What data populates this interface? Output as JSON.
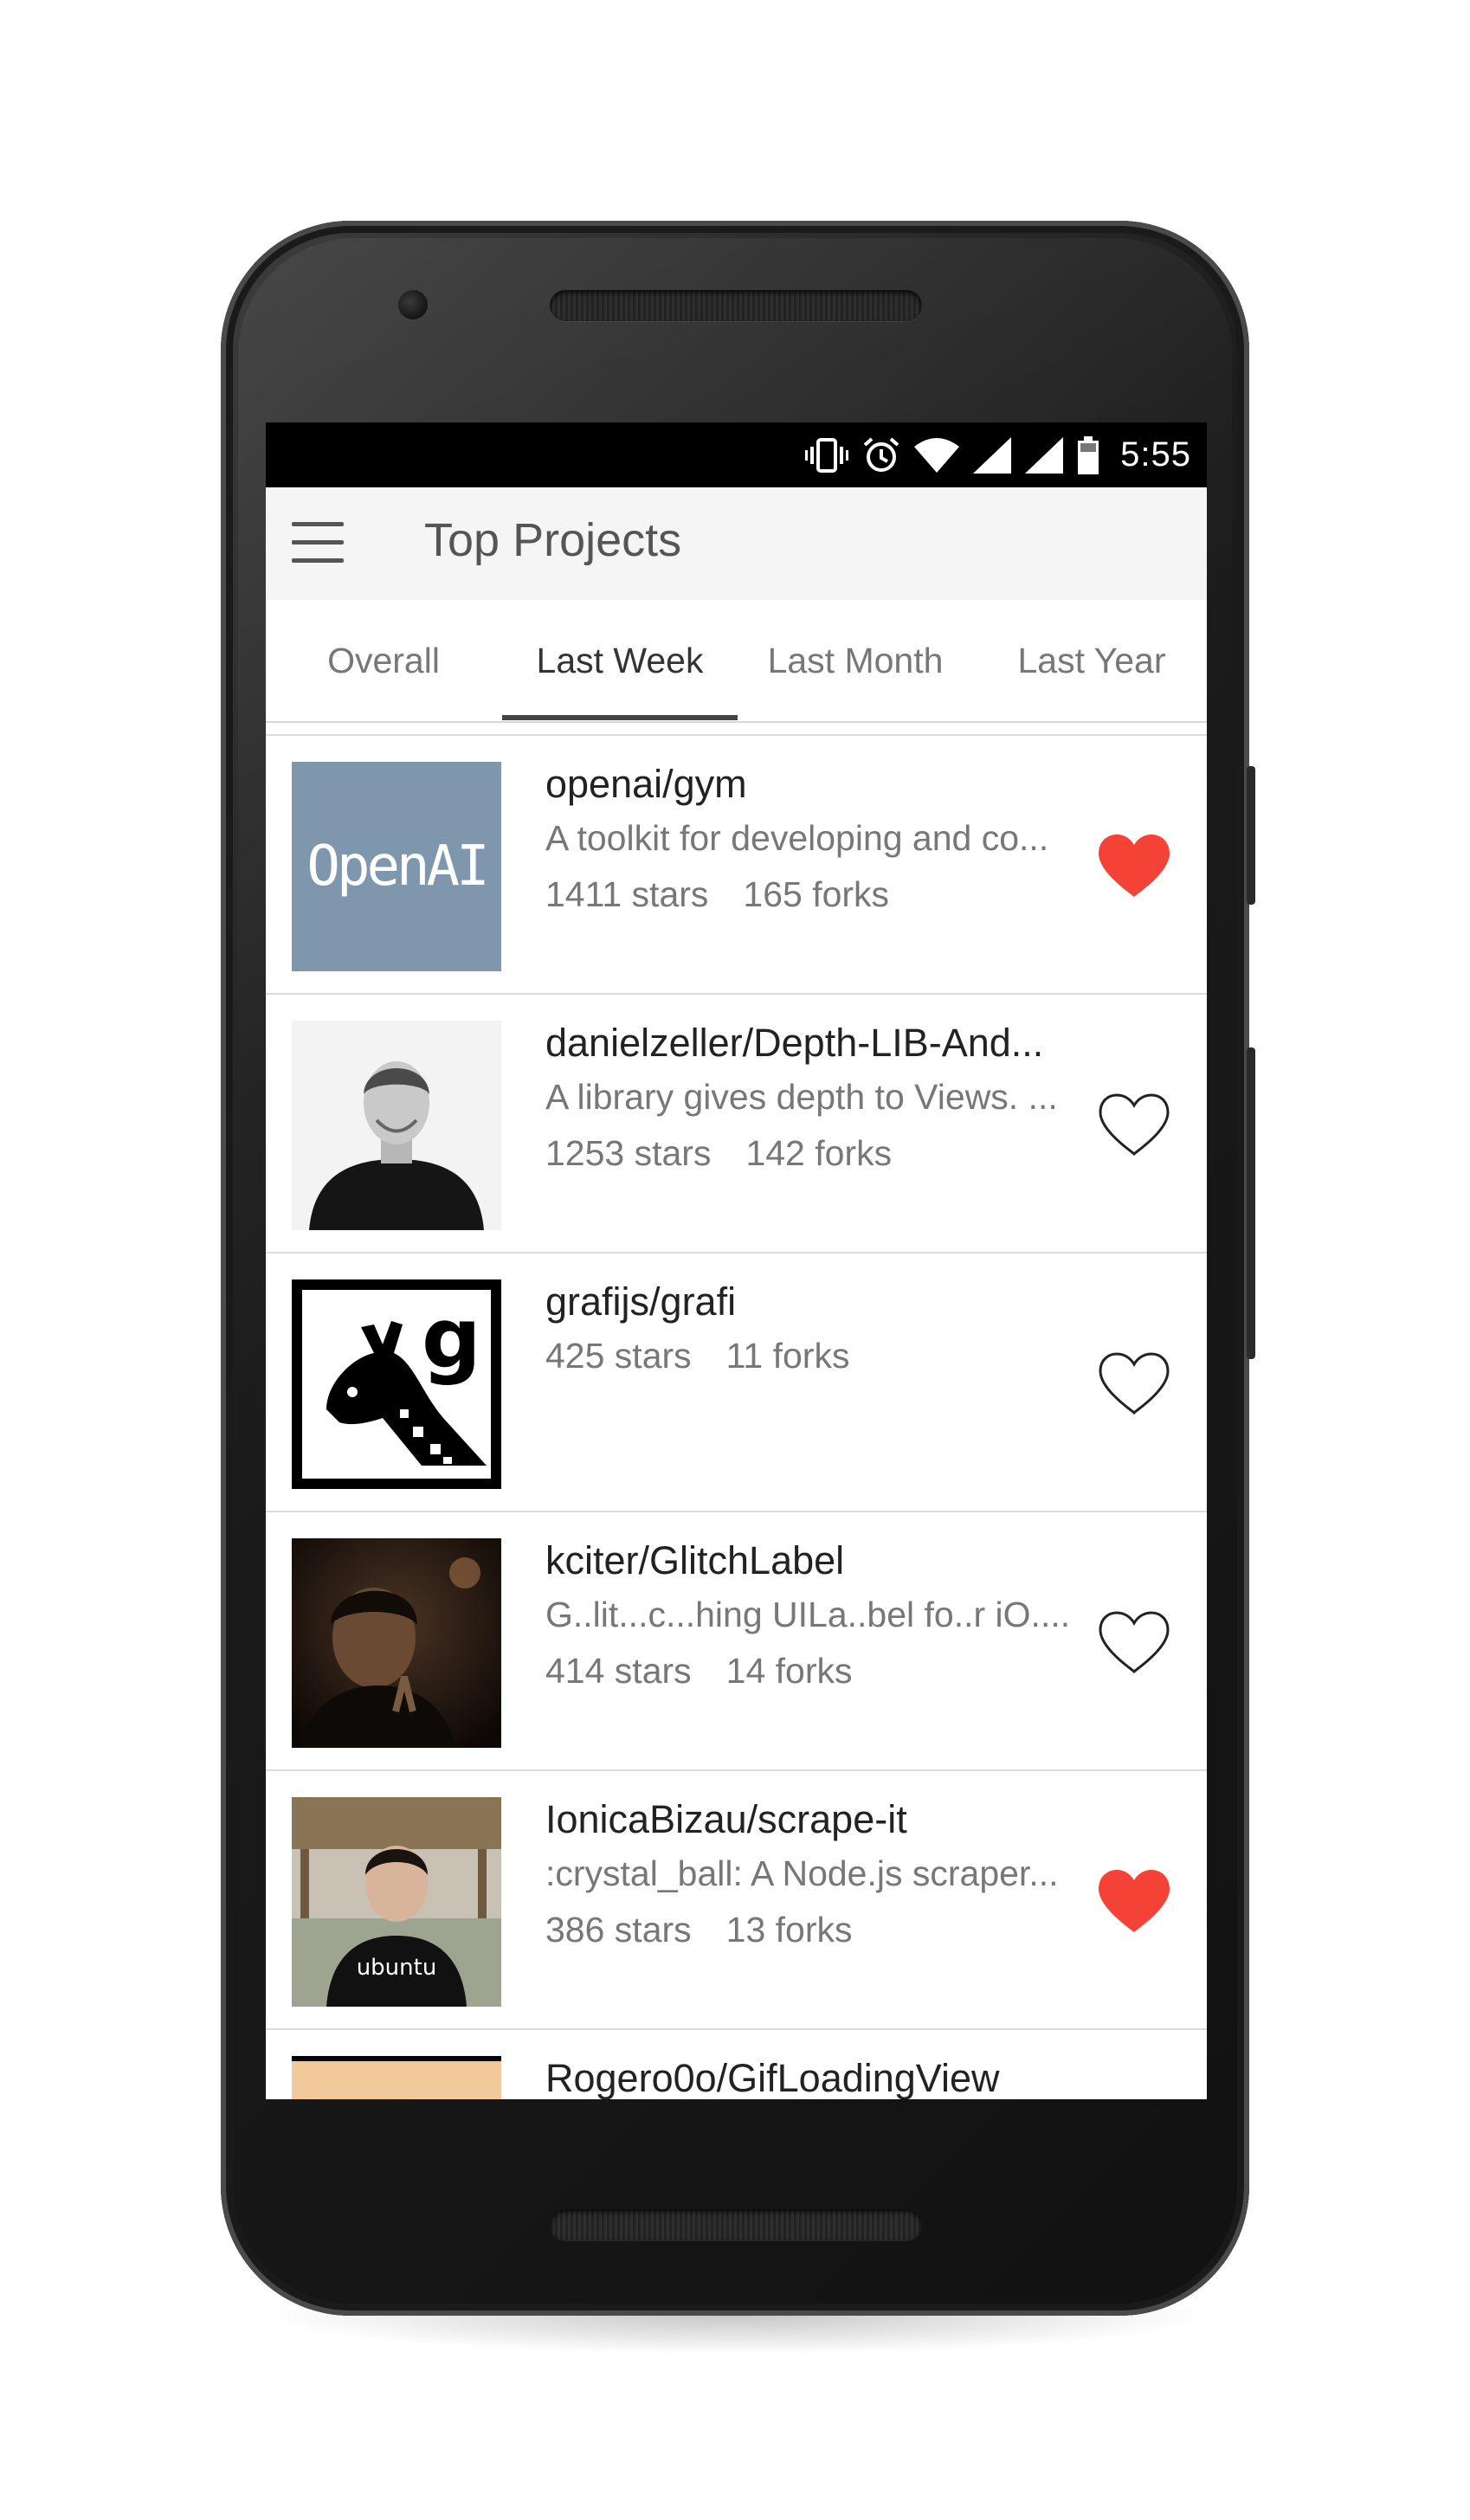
{
  "status_bar": {
    "time": "5:55"
  },
  "app_bar": {
    "title": "Top Projects"
  },
  "tabs": [
    {
      "label": "Overall"
    },
    {
      "label": "Last Week",
      "active": true
    },
    {
      "label": "Last Month"
    },
    {
      "label": "Last Year"
    }
  ],
  "projects": [
    {
      "name": "openai/gym",
      "description": "A toolkit for developing and co...",
      "stars": "1411 stars",
      "forks": "165 forks",
      "favorited": true,
      "avatar_text": "OpenAI"
    },
    {
      "name": "danielzeller/Depth-LIB-And...",
      "description": "A library gives depth to Views. ...",
      "stars": "1253 stars",
      "forks": "142 forks",
      "favorited": false
    },
    {
      "name": "grafijs/grafi",
      "description": "",
      "stars": "425 stars",
      "forks": "11 forks",
      "favorited": false,
      "avatar_text": "g"
    },
    {
      "name": "kciter/GlitchLabel",
      "description": "G..lit...c...hing UILa..bel fo..r iO....",
      "stars": "414 stars",
      "forks": "14 forks",
      "favorited": false
    },
    {
      "name": "IonicaBizau/scrape-it",
      "description": ":crystal_ball: A Node.js scraper...",
      "stars": "386 stars",
      "forks": "13 forks",
      "favorited": true,
      "avatar_text": "ubuntu"
    },
    {
      "name": "Rogero0o/GifLoadingView",
      "description": "",
      "stars": "",
      "forks": "",
      "favorited": false
    }
  ],
  "colors": {
    "heart_active": "#f44336",
    "app_bar": "#f5f5f5",
    "status_bar": "#000000"
  }
}
